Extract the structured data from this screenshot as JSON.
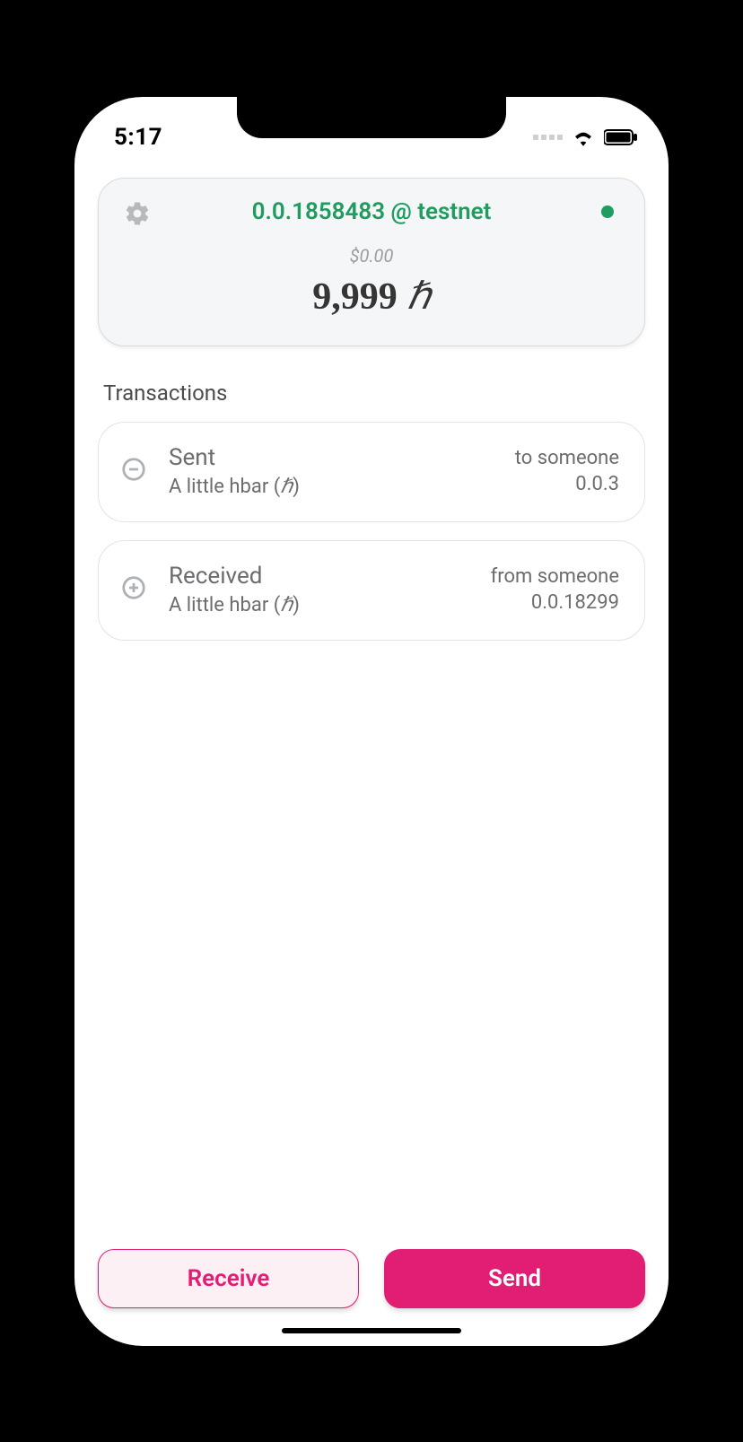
{
  "status": {
    "time": "5:17"
  },
  "card": {
    "account_label": "0.0.1858483 @ testnet",
    "usd": "$0.00",
    "hbar_amount": "9,999",
    "hbar_symbol": "ℏ"
  },
  "sections": {
    "transactions_title": "Transactions"
  },
  "transactions": [
    {
      "direction": "Sent",
      "amount_label": "A little hbar",
      "symbol": "ℏ",
      "who_label": "to someone",
      "address": "0.0.3"
    },
    {
      "direction": "Received",
      "amount_label": "A little hbar",
      "symbol": "ℏ",
      "who_label": "from someone",
      "address": "0.0.18299"
    }
  ],
  "footer": {
    "receive_label": "Receive",
    "send_label": "Send"
  },
  "colors": {
    "accent_green": "#1f9d60",
    "accent_pink": "#e11d74"
  }
}
